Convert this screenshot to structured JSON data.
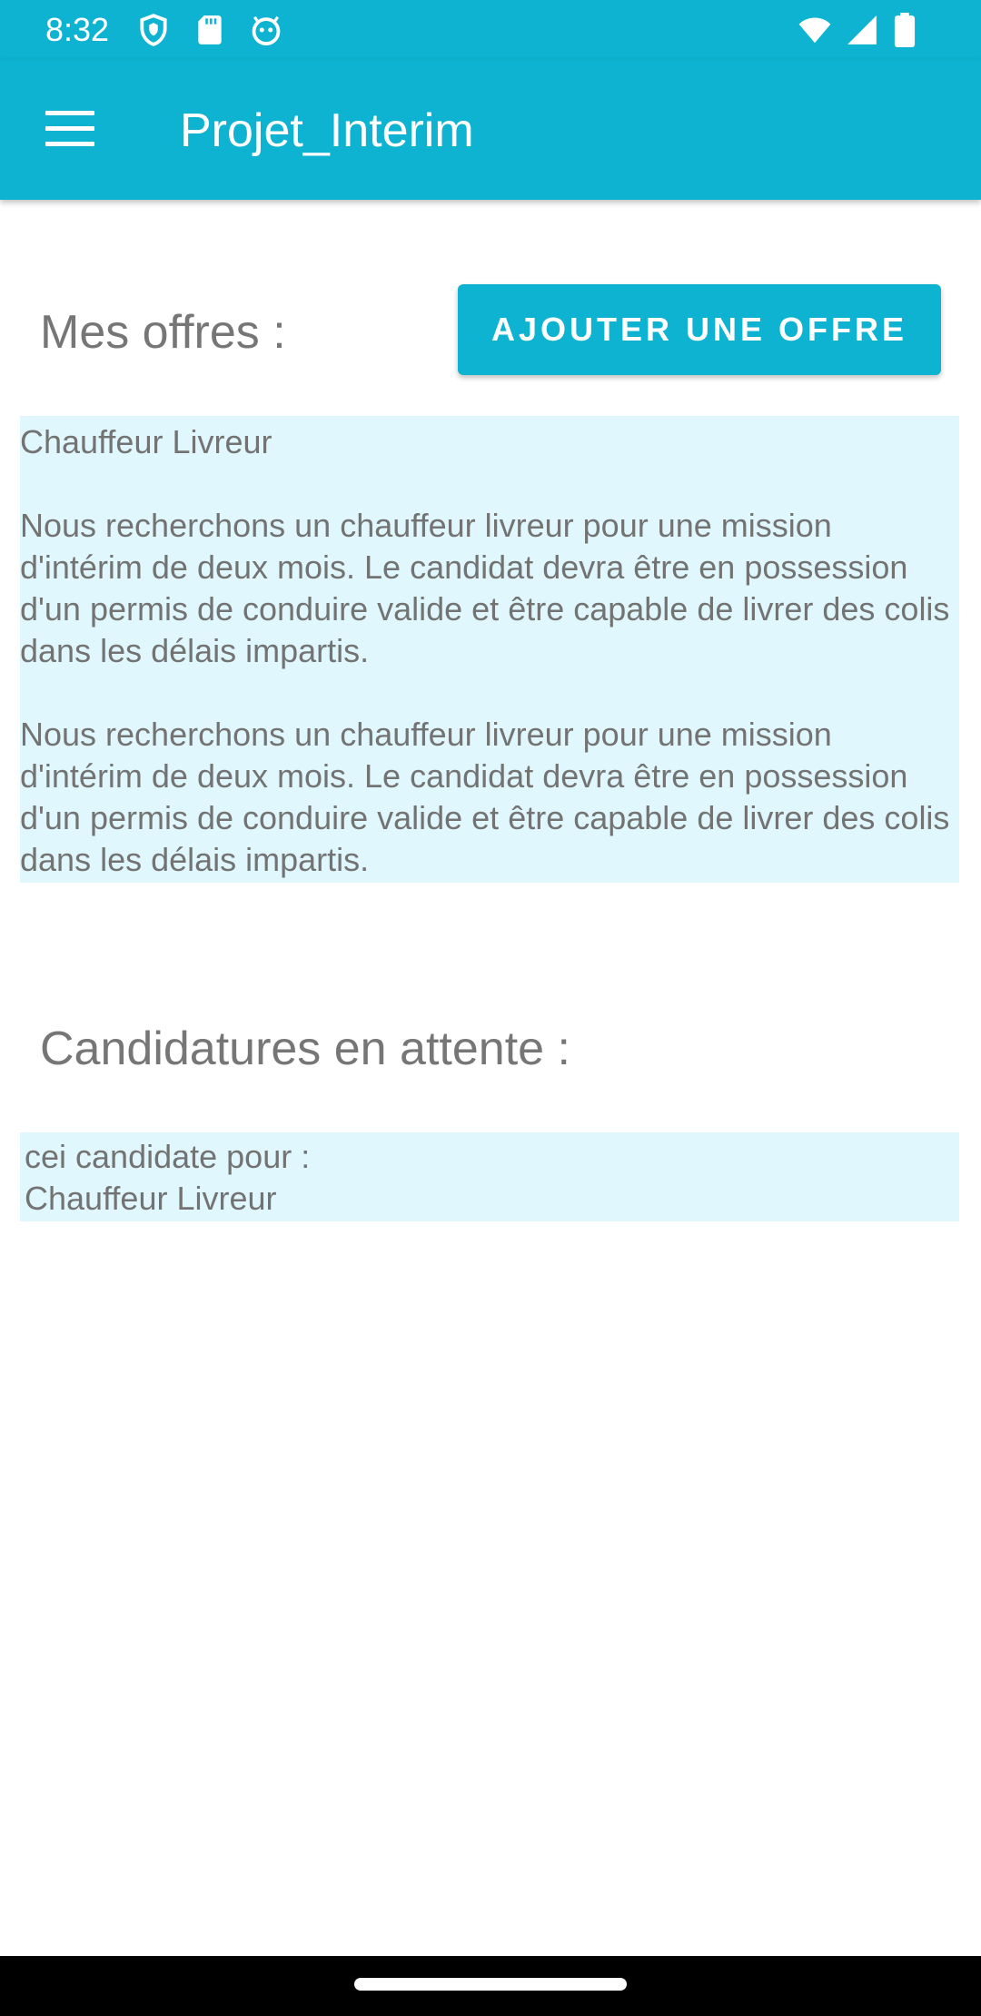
{
  "status_bar": {
    "time": "8:32",
    "left_icons": [
      "shield-icon",
      "sd-card-icon",
      "android-icon"
    ],
    "right_icons": [
      "wifi-icon",
      "signal-icon",
      "battery-icon"
    ]
  },
  "app_bar": {
    "title": "Projet_Interim",
    "menu_icon": "menu-icon"
  },
  "offers_section": {
    "title": "Mes offres :",
    "add_button_label": "AJOUTER UNE OFFRE",
    "offers": [
      {
        "title": "Chauffeur Livreur",
        "description_1": "Nous recherchons un chauffeur livreur pour une mission d'intérim de deux mois. Le candidat devra être en possession d'un permis de conduire valide et être capable de livrer des colis dans les délais impartis.",
        "description_2": "Nous recherchons un chauffeur livreur pour une mission d'intérim de deux mois. Le candidat devra être en possession d'un permis de conduire valide et être capable de livrer des colis dans les délais impartis."
      }
    ]
  },
  "applications_section": {
    "title": "Candidatures en attente :",
    "applications": [
      {
        "line_1": "cei candidate pour :",
        "line_2": "Chauffeur Livreur"
      }
    ]
  },
  "colors": {
    "primary": "#0db3d0",
    "card_background": "#e0f8fd",
    "text_gray": "#737373"
  }
}
